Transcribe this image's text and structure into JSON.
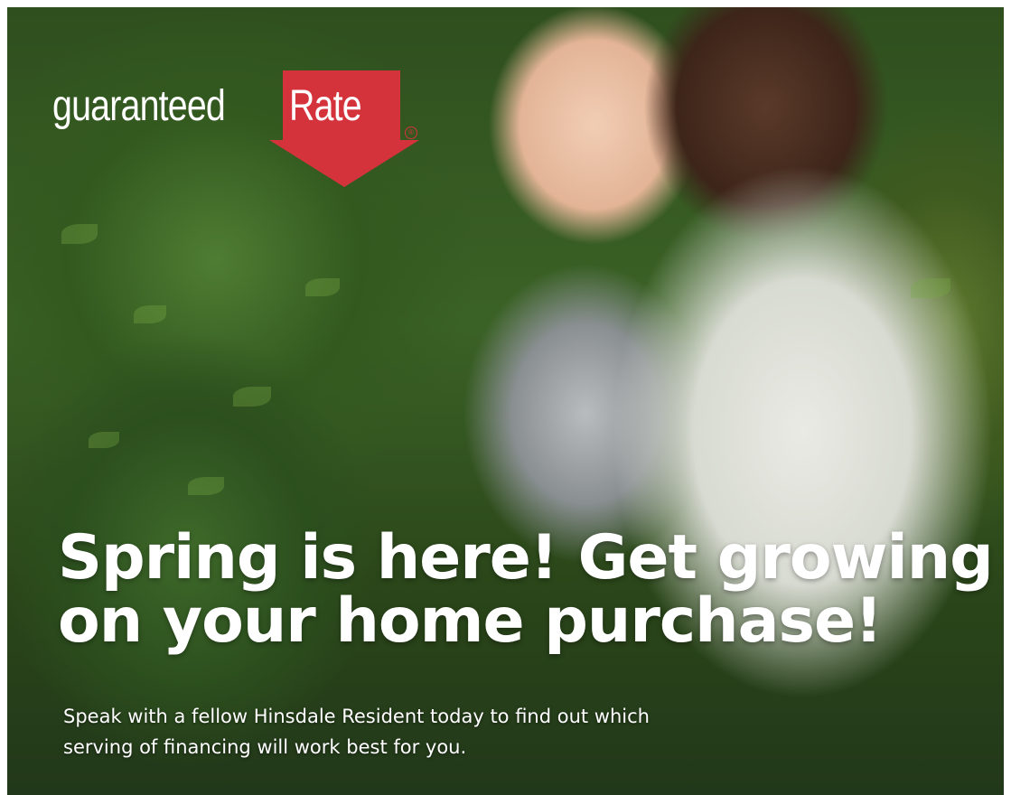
{
  "logo": {
    "word_left": "guaranteed",
    "word_right": "Rate",
    "registered_mark": "®",
    "brand_color": "#d4333c"
  },
  "headline": "Spring is here! Get growing on your home purchase!",
  "subtext": "Speak with a fellow Hinsdale Resident today to find out which serving of financing will work best for you.",
  "colors": {
    "text": "#ffffff",
    "accent": "#d4333c"
  }
}
